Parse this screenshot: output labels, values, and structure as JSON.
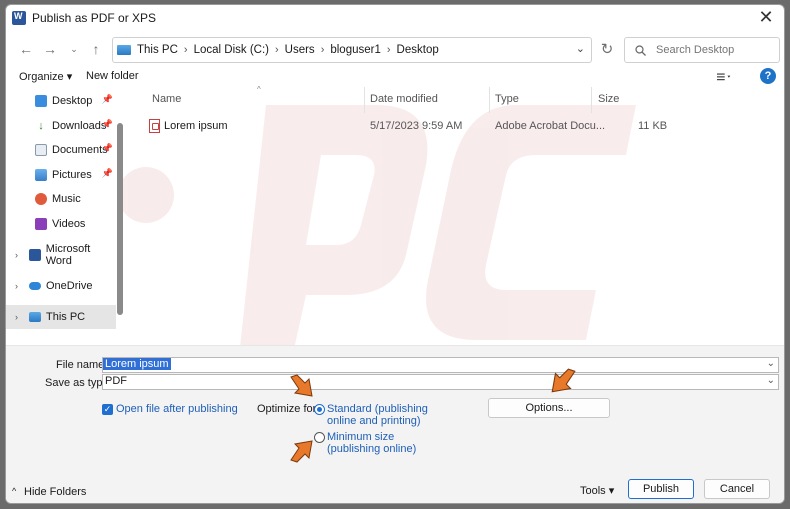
{
  "window": {
    "title": "Publish as PDF or XPS",
    "close_glyph": "✕"
  },
  "nav": {
    "breadcrumbs": [
      "This PC",
      "Local Disk (C:)",
      "Users",
      "bloguser1",
      "Desktop"
    ],
    "search_placeholder": "Search Desktop"
  },
  "toolbar": {
    "organize": "Organize ▾",
    "new_folder": "New folder",
    "help": "?"
  },
  "sidebar": {
    "items": [
      {
        "label": "Desktop",
        "icon": "desktop-icon",
        "pinned": true
      },
      {
        "label": "Downloads",
        "icon": "downloads-icon",
        "pinned": true
      },
      {
        "label": "Documents",
        "icon": "documents-icon",
        "pinned": true
      },
      {
        "label": "Pictures",
        "icon": "pictures-icon",
        "pinned": true
      },
      {
        "label": "Music",
        "icon": "music-icon",
        "pinned": false
      },
      {
        "label": "Videos",
        "icon": "videos-icon",
        "pinned": false
      },
      {
        "label": "Microsoft Word",
        "icon": "word-icon",
        "pinned": false
      },
      {
        "label": "OneDrive",
        "icon": "onedrive-icon",
        "pinned": false
      },
      {
        "label": "This PC",
        "icon": "this-pc-icon",
        "pinned": false
      }
    ]
  },
  "filelist": {
    "columns": [
      "Name",
      "Date modified",
      "Type",
      "Size"
    ],
    "rows": [
      {
        "name": "Lorem ipsum",
        "date": "5/17/2023 9:59 AM",
        "type": "Adobe Acrobat Docu...",
        "size": "11 KB"
      }
    ]
  },
  "form": {
    "file_name_label": "File name:",
    "file_name_value": "Lorem ipsum",
    "save_type_label": "Save as type:",
    "save_type_value": "PDF",
    "open_after_label": "Open file after publishing",
    "optimize_label": "Optimize for:",
    "standard_line1": "Standard (publishing",
    "standard_line2": "online and printing)",
    "minimum_line1": "Minimum size",
    "minimum_line2": "(publishing online)",
    "options_button": "Options...",
    "hide_folders": "Hide Folders",
    "tools": "Tools ▾",
    "publish": "Publish",
    "cancel": "Cancel"
  },
  "colors": {
    "accent": "#1e6fcf",
    "annotation_arrow": "#e8782a",
    "selection": "#2f6fd6"
  }
}
